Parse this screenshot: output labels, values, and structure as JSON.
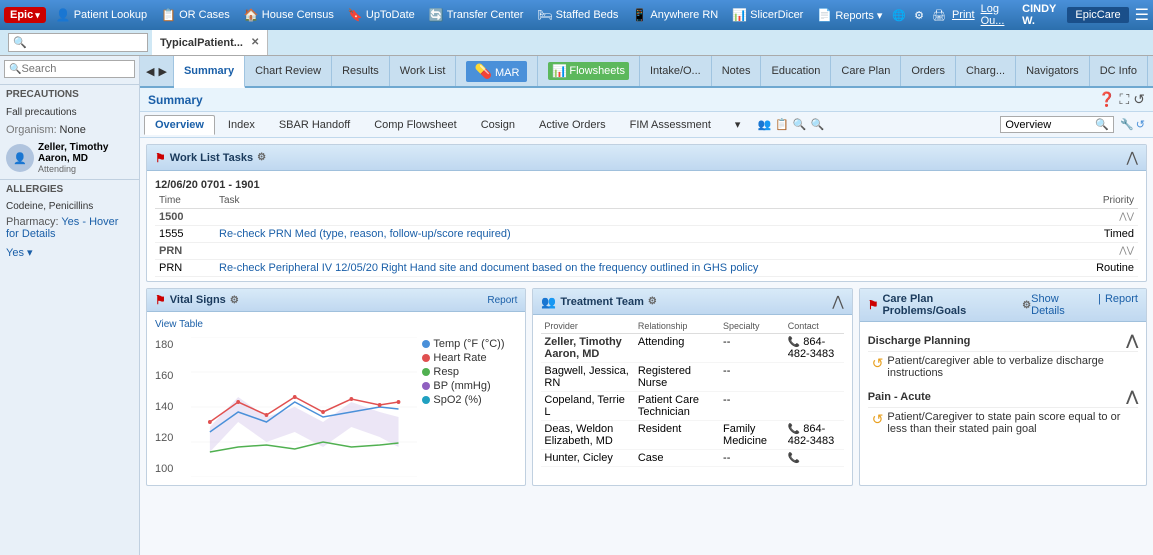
{
  "topbar": {
    "logo": "Epic",
    "nav_items": [
      {
        "id": "patient-lookup",
        "icon": "👤",
        "label": "Patient Lookup"
      },
      {
        "id": "or-cases",
        "icon": "📋",
        "label": "OR Cases"
      },
      {
        "id": "house-census",
        "icon": "🏠",
        "label": "House Census"
      },
      {
        "id": "uptodate",
        "icon": "🔖",
        "label": "UpToDate"
      },
      {
        "id": "transfer-center",
        "icon": "🔄",
        "label": "Transfer Center"
      },
      {
        "id": "staffed-beds",
        "icon": "🛏",
        "label": "Staffed Beds"
      },
      {
        "id": "anywhere-rn",
        "icon": "📱",
        "label": "Anywhere RN"
      },
      {
        "id": "slicerdicer",
        "icon": "📊",
        "label": "SlicerDicer"
      },
      {
        "id": "reports",
        "icon": "📄",
        "label": "Reports ▾"
      }
    ],
    "user": "CINDY W.",
    "print": "Print",
    "logout": "Log Ou..."
  },
  "tabbar": {
    "tab_label": "TypicalPatient...",
    "search_placeholder": ""
  },
  "patient_tabs": [
    {
      "id": "summary",
      "label": "Summary",
      "active": true
    },
    {
      "id": "chart-review",
      "label": "Chart Review"
    },
    {
      "id": "results",
      "label": "Results"
    },
    {
      "id": "work-list",
      "label": "Work List"
    },
    {
      "id": "mar",
      "label": "MAR",
      "special": "mar"
    },
    {
      "id": "flowsheets",
      "label": "Flowsheets",
      "special": "flowsheets"
    },
    {
      "id": "intake",
      "label": "Intake/O..."
    },
    {
      "id": "notes",
      "label": "Notes"
    },
    {
      "id": "education",
      "label": "Education"
    },
    {
      "id": "care-plan",
      "label": "Care Plan"
    },
    {
      "id": "orders",
      "label": "Orders"
    },
    {
      "id": "charg",
      "label": "Charg..."
    },
    {
      "id": "navigators",
      "label": "Navigators"
    },
    {
      "id": "dc-info",
      "label": "DC Info"
    }
  ],
  "summary_title": "Summary",
  "overview_tabs": [
    {
      "id": "overview",
      "label": "Overview",
      "active": true
    },
    {
      "id": "index",
      "label": "Index"
    },
    {
      "id": "sbar-handoff",
      "label": "SBAR Handoff"
    },
    {
      "id": "comp-flowsheet",
      "label": "Comp Flowsheet"
    },
    {
      "id": "cosign",
      "label": "Cosign"
    },
    {
      "id": "active-orders",
      "label": "Active Orders"
    },
    {
      "id": "fim-assessment",
      "label": "FIM Assessment"
    },
    {
      "id": "more",
      "label": "▾"
    }
  ],
  "ov_search_value": "Overview",
  "worklist": {
    "title": "Work List Tasks",
    "flag": "⚑",
    "date_range": "12/06/20 0701 - 1901",
    "columns": [
      "Time",
      "Task",
      "",
      "",
      "Priority"
    ],
    "rows": [
      {
        "time": "1500",
        "task": "",
        "priority": "",
        "is_header": true
      },
      {
        "time": "1555",
        "task": "Re-check PRN Med (type, reason, follow-up/score required)",
        "priority": "Timed",
        "is_link": true
      },
      {
        "time": "PRN",
        "task": "",
        "priority": "",
        "is_header": true
      },
      {
        "time": "PRN",
        "task": "Re-check Peripheral IV 12/05/20 Right Hand site and document based on the frequency outlined in GHS policy",
        "priority": "Routine",
        "is_link": true
      }
    ]
  },
  "vital_signs": {
    "title": "Vital Signs",
    "flag": "⚑",
    "report_label": "Report",
    "view_table": "View Table",
    "y_labels": [
      "180",
      "160",
      "140",
      "120",
      "100"
    ],
    "legend": [
      {
        "label": "Temp (°F (°C))",
        "color": "#4a90d9"
      },
      {
        "label": "Heart Rate",
        "color": "#e05050"
      },
      {
        "label": "Resp",
        "color": "#50b050"
      },
      {
        "label": "BP (mmHg)",
        "color": "#9060c0"
      },
      {
        "label": "SpO2 (%)",
        "color": "#20a0c0"
      }
    ]
  },
  "treatment_team": {
    "title": "Treatment Team",
    "flag": "⚑",
    "columns": [
      "Provider",
      "Relationship",
      "Specialty",
      "Contact"
    ],
    "rows": [
      {
        "provider": "Zeller, Timothy Aaron, MD",
        "relationship": "Attending",
        "specialty": "--",
        "contact": "864-482-3483",
        "has_phone": true
      },
      {
        "provider": "Bagwell, Jessica, RN",
        "relationship": "Registered Nurse",
        "specialty": "--",
        "contact": ""
      },
      {
        "provider": "Copeland, Terrie L",
        "relationship": "Patient Care Technician",
        "specialty": "--",
        "contact": ""
      },
      {
        "provider": "Deas, Weldon Elizabeth, MD",
        "relationship": "Resident",
        "specialty": "Family Medicine",
        "contact": "864-482-3483",
        "has_phone": true
      },
      {
        "provider": "Hunter, Cicley",
        "relationship": "Case",
        "specialty": "--",
        "contact": "",
        "has_phone": true
      }
    ]
  },
  "care_plan": {
    "title": "Care Plan Problems/Goals",
    "flag": "⚑",
    "show_details": "Show Details",
    "report": "Report",
    "sections": [
      {
        "title": "Discharge Planning",
        "items": [
          "Patient/caregiver able to verbalize discharge instructions"
        ]
      },
      {
        "title": "Pain - Acute",
        "items": [
          "Patient/Caregiver to state pain score equal to or less than their stated pain goal"
        ]
      }
    ]
  },
  "sidebar": {
    "search_placeholder": "Search",
    "precautions_label": "PRECAUTIONS",
    "precautions_value": "Fall precautions",
    "organism_label": "Organism:",
    "organism_value": "None",
    "attending_label": "Attending",
    "doctor_name": "Zeller, Timothy Aaron, MD",
    "doctor_role": "Attending",
    "allergies_label": "ALLERGIES",
    "allergies_value": "Codeine, Penicillins",
    "pharmacy_label": "Pharmacy:",
    "pharmacy_value": "Yes - Hover for Details",
    "yes_dropdown": "Yes ▾"
  }
}
